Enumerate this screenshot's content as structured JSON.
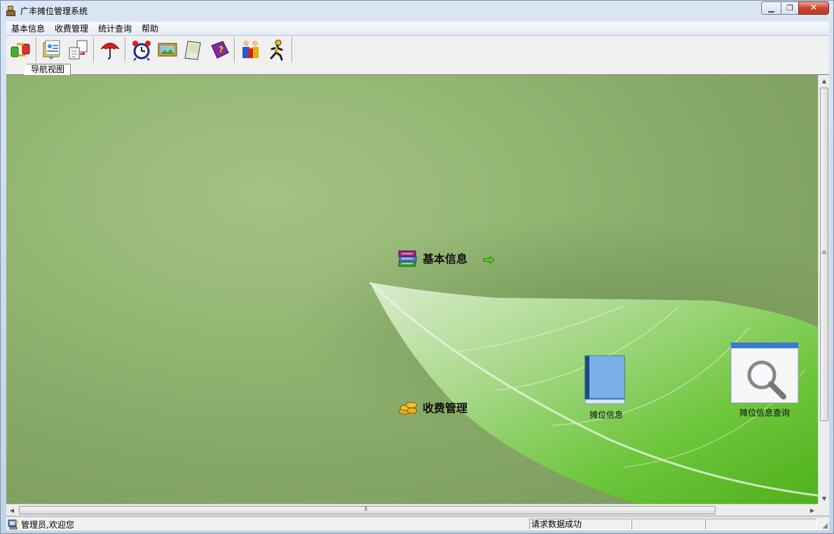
{
  "window": {
    "title": "广丰摊位管理系统"
  },
  "menu": {
    "items": [
      "基本信息",
      "收费管理",
      "统计查询",
      "帮助"
    ]
  },
  "toolbar": {
    "buttons": [
      {
        "icon": "data-transfer-icon"
      },
      {
        "icon": "folder-contacts-icon"
      },
      {
        "icon": "document-exchange-icon"
      },
      {
        "icon": "umbrella-icon"
      },
      {
        "icon": "alarm-clock-icon"
      },
      {
        "icon": "picture-frame-icon"
      },
      {
        "icon": "notepad-icon"
      },
      {
        "icon": "help-book-icon"
      },
      {
        "icon": "users-icon"
      },
      {
        "icon": "exit-runner-icon"
      }
    ]
  },
  "tabs": {
    "active": "导航视图"
  },
  "nav": {
    "basic_info": "基本信息",
    "fee_management": "收费管理"
  },
  "features": {
    "stall_info": "摊位信息",
    "stall_query": "摊位信息查询"
  },
  "statusbar": {
    "user": "管理员,欢迎您",
    "message": "请求数据成功"
  },
  "colors": {
    "background_green": "#8fb06d",
    "leaf_green": "#5cc02a",
    "titlebar": "#cfdcec"
  }
}
